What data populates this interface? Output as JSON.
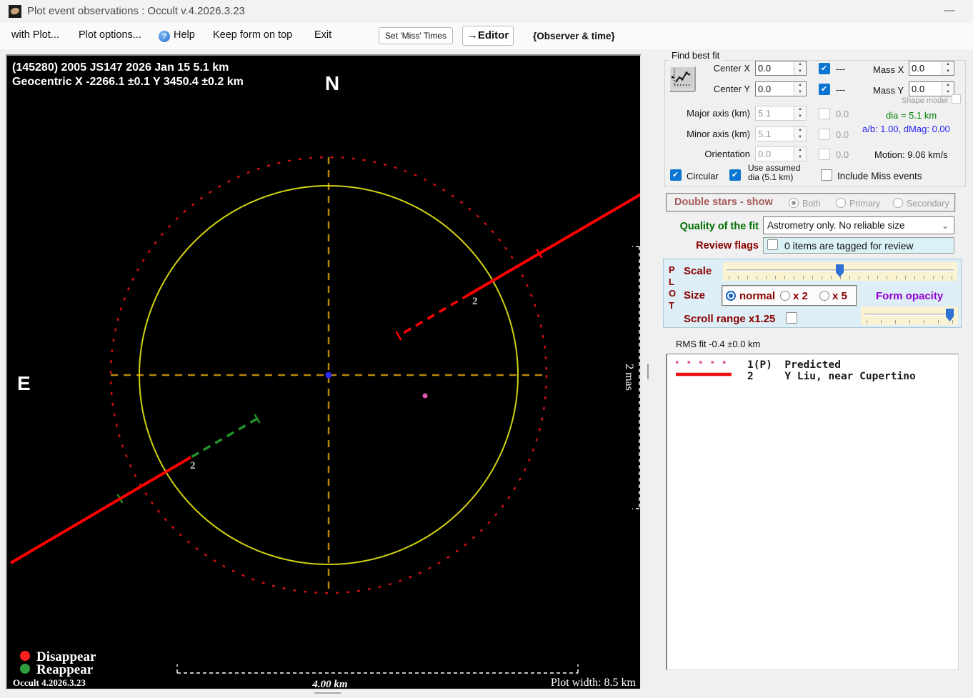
{
  "window": {
    "title": "Plot event observations : Occult v.4.2026.3.23",
    "minimize_glyph": "—"
  },
  "menubar": {
    "items": [
      {
        "label": "with Plot..."
      },
      {
        "label": "Plot options..."
      },
      {
        "label": "Help"
      },
      {
        "label": "Keep form on top"
      },
      {
        "label": "Exit"
      }
    ],
    "set_miss_button": "Set 'Miss' Times",
    "editor_button": "→Editor",
    "observer_note": "{Observer & time}"
  },
  "plot": {
    "title_line1": "(145280) 2005 JS147  2026 Jan 15   5.1 km",
    "title_line2": "Geocentric  X  -2266.1 ±0.1  Y 3450.4 ±0.2 km",
    "north_label": "N",
    "east_label": "E",
    "chord_label_upper": "2",
    "chord_label_lower": "2",
    "vertical_scale_label": "2 mas",
    "horizontal_scale_label": "4.00 km",
    "legend": {
      "disappear": "Disappear",
      "reappear": "Reappear"
    },
    "version_label": "Occult 4.2026.3.23",
    "plot_width_label": "Plot width: 8.5 km",
    "colors": {
      "predicted_path": "#ff0000",
      "reappear_segment": "#23922b",
      "asteroid_outline": "#d2d210",
      "uncertainty_circle": "#cc1111",
      "crosshair": "#b8860b",
      "center_dot": "#2a2af0",
      "star_dot": "#d957b2"
    }
  },
  "find_best_fit": {
    "group_label": "Find best fit",
    "rows": {
      "center_x": {
        "label": "Center X",
        "value": "0.0",
        "aux": "---"
      },
      "center_y": {
        "label": "Center Y",
        "value": "0.0",
        "aux": "---"
      },
      "mass_x": {
        "label": "Mass X",
        "value": "0.0"
      },
      "mass_y": {
        "label": "Mass Y",
        "value": "0.0"
      },
      "major_axis": {
        "label": "Major axis (km)",
        "value": "5.1",
        "aux": "0.0"
      },
      "minor_axis": {
        "label": "Minor axis (km)",
        "value": "5.1",
        "aux": "0.0"
      },
      "orientation": {
        "label": "Orientation",
        "value": "0.0",
        "aux": "0.0"
      }
    },
    "shape_model_label": "Shape model",
    "dia_label": "dia = 5.1 km",
    "ab_label": "a/b: 1.00, dMag: 0.00",
    "motion_label": "Motion: 9.06 km/s",
    "circular_label": "Circular",
    "use_assumed_line1": "Use assumed",
    "use_assumed_line2": "dia (5.1 km)",
    "include_miss_label": "Include Miss events"
  },
  "double_stars": {
    "label": "Double stars - show",
    "options": [
      {
        "label": "Both",
        "selected": true
      },
      {
        "label": "Primary",
        "selected": false
      },
      {
        "label": "Secondary",
        "selected": false
      }
    ]
  },
  "quality_fit": {
    "label": "Quality of the fit",
    "value": "Astrometry only. No reliable size"
  },
  "review_flags": {
    "label": "Review flags",
    "value": "0 items are tagged for review"
  },
  "plot_controls": {
    "vertical_label": [
      "P",
      "L",
      "O",
      "T"
    ],
    "scale_label": "Scale",
    "size_label": "Size",
    "size_options": [
      {
        "label": "normal",
        "selected": true
      },
      {
        "label": "x 2",
        "selected": false
      },
      {
        "label": "x 5",
        "selected": false
      }
    ],
    "form_opacity_label": "Form opacity",
    "scroll_range_label": "Scroll range x1.25"
  },
  "rms_fit_label": "RMS fit -0.4 ±0.0 km",
  "observations": [
    {
      "id": "1(P)",
      "name": "Predicted",
      "line_style": "dotted-pink",
      "text": "1(P)  Predicted"
    },
    {
      "id": "2",
      "name": "Y Liu, near Cupertino",
      "line_style": "solid-red",
      "text": "2     Y Liu, near Cupertino"
    }
  ]
}
